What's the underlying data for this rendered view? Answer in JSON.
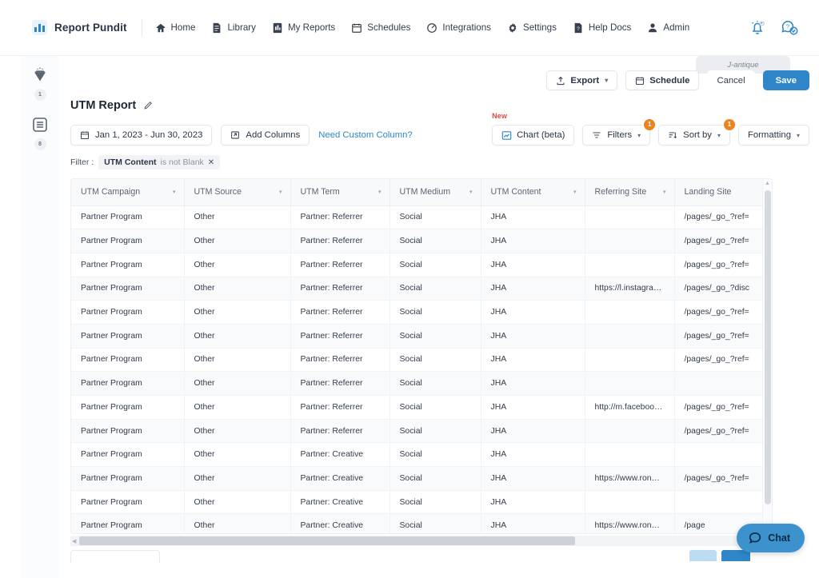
{
  "nav": {
    "brand": "Report Pundit",
    "items": [
      {
        "label": "Home",
        "icon": "home-icon"
      },
      {
        "label": "Library",
        "icon": "book-icon"
      },
      {
        "label": "My Reports",
        "icon": "report-icon"
      },
      {
        "label": "Schedules",
        "icon": "calendar-icon"
      },
      {
        "label": "Integrations",
        "icon": "plug-icon"
      },
      {
        "label": "Settings",
        "icon": "gear-icon"
      },
      {
        "label": "Help Docs",
        "icon": "doc-help-icon"
      },
      {
        "label": "Admin",
        "icon": "user-shield-icon"
      }
    ],
    "right_icons": [
      {
        "name": "notification-bell-icon"
      },
      {
        "name": "support-chat-icon"
      }
    ]
  },
  "rail": {
    "items": [
      {
        "icon": "diamond-icon",
        "badge": "1"
      },
      {
        "icon": "list-icon",
        "badge": "8"
      }
    ]
  },
  "account_tab": {
    "label": "J-antique"
  },
  "actions": {
    "export_label": "Export",
    "export_caret": "▾",
    "schedule_label": "Schedule",
    "cancel_label": "Cancel",
    "save_label": "Save"
  },
  "report": {
    "title": "UTM Report",
    "date_range": "Jan 1, 2023 - Jun 30, 2023",
    "add_columns_label": "Add Columns",
    "custom_column_link": "Need Custom Column?"
  },
  "view_tools": {
    "new_tag": "New",
    "chart_label": "Chart (beta)",
    "filters_label": "Filters",
    "filters_count": "1",
    "sort_label": "Sort by",
    "sort_count": "1",
    "formatting_label": "Formatting",
    "caret": "▾"
  },
  "filter_bar": {
    "prefix": "Filter :",
    "field": "UTM Content",
    "operator": "is not Blank",
    "remove": "✕"
  },
  "table": {
    "sort_caret": "▾",
    "columns": [
      "UTM Campaign",
      "UTM Source",
      "UTM Term",
      "UTM Medium",
      "UTM Content",
      "Referring Site",
      "Landing Site"
    ],
    "rows": [
      [
        "Partner Program",
        "Other",
        "Partner: Referrer",
        "Social",
        "JHA",
        "",
        "/pages/_go_?ref="
      ],
      [
        "Partner Program",
        "Other",
        "Partner: Referrer",
        "Social",
        "JHA",
        "",
        "/pages/_go_?ref="
      ],
      [
        "Partner Program",
        "Other",
        "Partner: Referrer",
        "Social",
        "JHA",
        "",
        "/pages/_go_?ref="
      ],
      [
        "Partner Program",
        "Other",
        "Partner: Referrer",
        "Social",
        "JHA",
        "https://l.instagram.co...",
        "/pages/_go_?disc"
      ],
      [
        "Partner Program",
        "Other",
        "Partner: Referrer",
        "Social",
        "JHA",
        "",
        "/pages/_go_?ref="
      ],
      [
        "Partner Program",
        "Other",
        "Partner: Referrer",
        "Social",
        "JHA",
        "",
        "/pages/_go_?ref="
      ],
      [
        "Partner Program",
        "Other",
        "Partner: Referrer",
        "Social",
        "JHA",
        "",
        "/pages/_go_?ref="
      ],
      [
        "Partner Program",
        "Other",
        "Partner: Referrer",
        "Social",
        "JHA",
        "",
        ""
      ],
      [
        "Partner Program",
        "Other",
        "Partner: Referrer",
        "Social",
        "JHA",
        "http://m.facebook.co...",
        "/pages/_go_?ref="
      ],
      [
        "Partner Program",
        "Other",
        "Partner: Referrer",
        "Social",
        "JHA",
        "",
        "/pages/_go_?ref="
      ],
      [
        "Partner Program",
        "Other",
        "Partner: Creative",
        "Social",
        "JHA",
        "",
        ""
      ],
      [
        "Partner Program",
        "Other",
        "Partner: Creative",
        "Social",
        "JHA",
        "https://www.rona.ca/en",
        "/pages/_go_?ref="
      ],
      [
        "Partner Program",
        "Other",
        "Partner: Creative",
        "Social",
        "JHA",
        "",
        ""
      ],
      [
        "Partner Program",
        "Other",
        "Partner: Creative",
        "Social",
        "JHA",
        "https://www.rona.ca/en",
        "/page"
      ]
    ]
  },
  "chat": {
    "label": "Chat"
  },
  "colors": {
    "primary": "#2e86c8",
    "badge": "#f0821e",
    "new_tag": "#e04a3f",
    "link": "#2e86c8"
  }
}
